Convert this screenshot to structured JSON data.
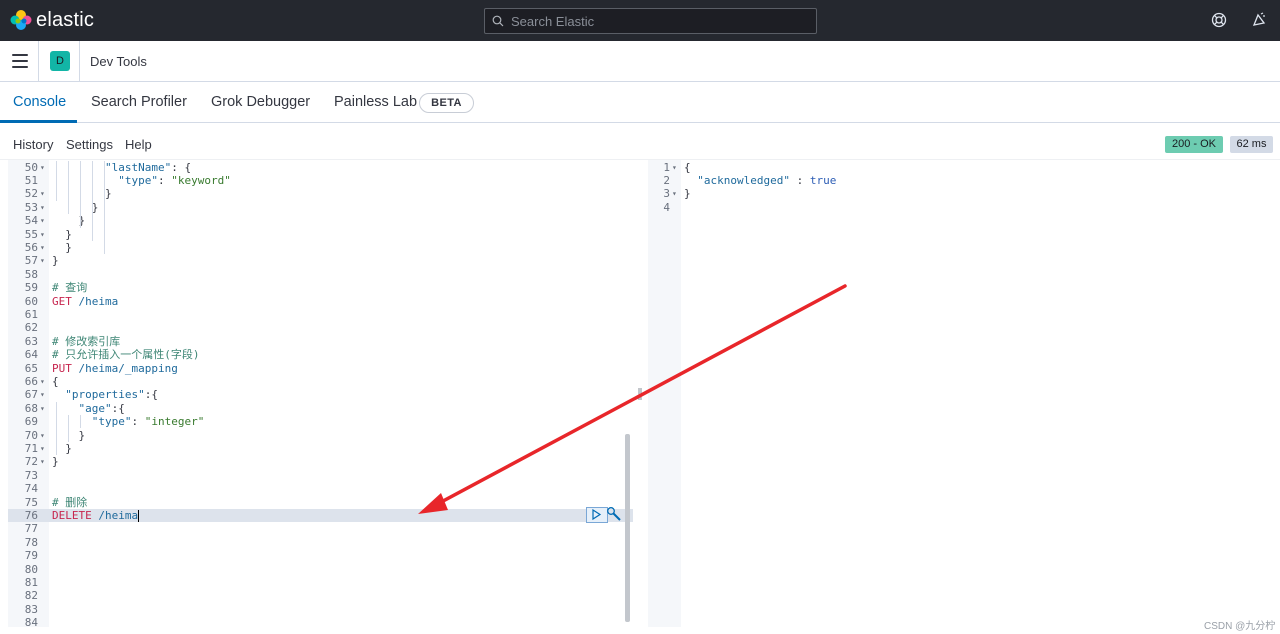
{
  "app": {
    "brand": "elastic",
    "search_placeholder": "Search Elastic"
  },
  "breadcrumb": {
    "avatar_initial": "D",
    "title": "Dev Tools"
  },
  "tabs": [
    {
      "label": "Console",
      "active": true
    },
    {
      "label": "Search Profiler"
    },
    {
      "label": "Grok Debugger"
    },
    {
      "label": "Painless Lab"
    }
  ],
  "beta_badge": "BETA",
  "toolbar": {
    "history": "History",
    "settings": "Settings",
    "help": "Help"
  },
  "response_status": {
    "status": "200 - OK",
    "time": "62 ms",
    "status_color": "#6dccb1"
  },
  "request_editor": {
    "lines": [
      {
        "n": "50",
        "fold": true,
        "text": "        \"lastName\": {"
      },
      {
        "n": "51",
        "fold": false,
        "text": "          \"type\": \"keyword\""
      },
      {
        "n": "52",
        "fold": true,
        "text": "        }"
      },
      {
        "n": "53",
        "fold": true,
        "text": "      }"
      },
      {
        "n": "54",
        "fold": true,
        "text": "    }"
      },
      {
        "n": "55",
        "fold": true,
        "text": "  }"
      },
      {
        "n": "56",
        "fold": true,
        "text": "  }"
      },
      {
        "n": "57",
        "fold": true,
        "text": "}"
      },
      {
        "n": "58",
        "fold": false,
        "text": ""
      },
      {
        "n": "59",
        "fold": false,
        "text": "# 查询"
      },
      {
        "n": "60",
        "fold": false,
        "text": "GET /heima"
      },
      {
        "n": "61",
        "fold": false,
        "text": ""
      },
      {
        "n": "62",
        "fold": false,
        "text": ""
      },
      {
        "n": "63",
        "fold": false,
        "text": "# 修改索引库"
      },
      {
        "n": "64",
        "fold": false,
        "text": "# 只允许插入一个属性(字段)"
      },
      {
        "n": "65",
        "fold": false,
        "text": "PUT /heima/_mapping"
      },
      {
        "n": "66",
        "fold": true,
        "text": "{"
      },
      {
        "n": "67",
        "fold": true,
        "text": "  \"properties\":{"
      },
      {
        "n": "68",
        "fold": true,
        "text": "    \"age\":{"
      },
      {
        "n": "69",
        "fold": false,
        "text": "      \"type\": \"integer\""
      },
      {
        "n": "70",
        "fold": true,
        "text": "    }"
      },
      {
        "n": "71",
        "fold": true,
        "text": "  }"
      },
      {
        "n": "72",
        "fold": true,
        "text": "}"
      },
      {
        "n": "73",
        "fold": false,
        "text": ""
      },
      {
        "n": "74",
        "fold": false,
        "text": ""
      },
      {
        "n": "75",
        "fold": false,
        "text": "# 删除"
      },
      {
        "n": "76",
        "fold": false,
        "text": "DELETE /heima",
        "active": true
      },
      {
        "n": "77",
        "fold": false,
        "text": ""
      },
      {
        "n": "78",
        "fold": false,
        "text": ""
      },
      {
        "n": "79",
        "fold": false,
        "text": ""
      },
      {
        "n": "80",
        "fold": false,
        "text": ""
      },
      {
        "n": "81",
        "fold": false,
        "text": ""
      },
      {
        "n": "82",
        "fold": false,
        "text": ""
      },
      {
        "n": "83",
        "fold": false,
        "text": ""
      },
      {
        "n": "84",
        "fold": false,
        "text": ""
      }
    ]
  },
  "response_editor": {
    "lines": [
      {
        "n": "1",
        "fold": true,
        "text": "{"
      },
      {
        "n": "2",
        "fold": false,
        "text": "  \"acknowledged\" : true"
      },
      {
        "n": "3",
        "fold": true,
        "text": "}"
      },
      {
        "n": "4",
        "fold": false,
        "text": ""
      }
    ]
  },
  "watermark": "CSDN @九分柠"
}
